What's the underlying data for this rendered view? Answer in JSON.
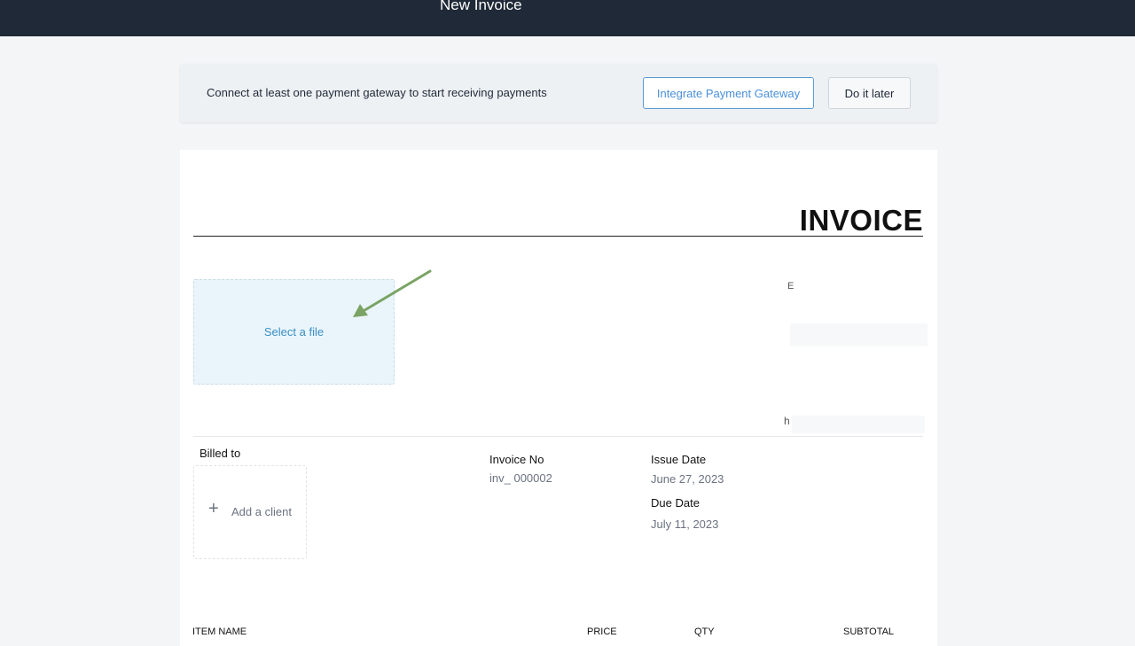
{
  "header": {
    "title": "New Invoice"
  },
  "gateway_banner": {
    "message": "Connect at least one payment gateway to start receiving payments",
    "integrate_label": "Integrate Payment Gateway",
    "later_label": "Do it later"
  },
  "invoice": {
    "heading": "INVOICE",
    "logo_upload_label": "Select a file",
    "company_fragments": [
      "E",
      "h"
    ],
    "billed_to_label": "Billed to",
    "add_client_label": "Add a client",
    "invoice_no_label": "Invoice No",
    "invoice_no_value": "inv_ 000002",
    "issue_date_label": "Issue Date",
    "issue_date_value": "June 27, 2023",
    "due_date_label": "Due Date",
    "due_date_value": "July 11, 2023",
    "columns": [
      "ITEM NAME",
      "PRICE",
      "QTY",
      "SUBTOTAL"
    ]
  },
  "colors": {
    "topbar": "#1f2937",
    "accent": "#4a90d9",
    "annotation_arrow": "#7aa364"
  }
}
